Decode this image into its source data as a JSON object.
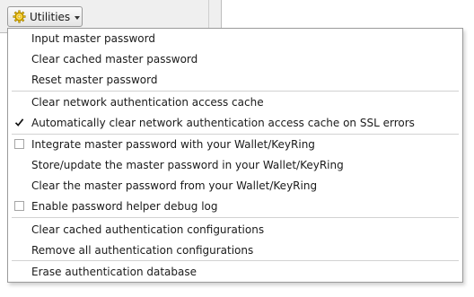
{
  "toolbar": {
    "utilities_label": "Utilities",
    "utilities_icon": "gear-icon"
  },
  "menu": {
    "items": [
      {
        "label": "Input master password",
        "check": "none"
      },
      {
        "label": "Clear cached master password",
        "check": "none"
      },
      {
        "label": "Reset master password",
        "check": "none"
      },
      {
        "label": "Clear network authentication access cache",
        "check": "none"
      },
      {
        "label": "Automatically clear network authentication access cache on SSL errors",
        "check": "checked"
      },
      {
        "label": "Integrate master password with your Wallet/KeyRing",
        "check": "unchecked"
      },
      {
        "label": "Store/update the master password in your Wallet/KeyRing",
        "check": "none"
      },
      {
        "label": "Clear the master password from your Wallet/KeyRing",
        "check": "none"
      },
      {
        "label": "Enable password helper debug log",
        "check": "unchecked"
      },
      {
        "label": "Clear cached authentication configurations",
        "check": "none"
      },
      {
        "label": "Remove all authentication configurations",
        "check": "none"
      },
      {
        "label": "Erase authentication database",
        "check": "none"
      }
    ]
  }
}
